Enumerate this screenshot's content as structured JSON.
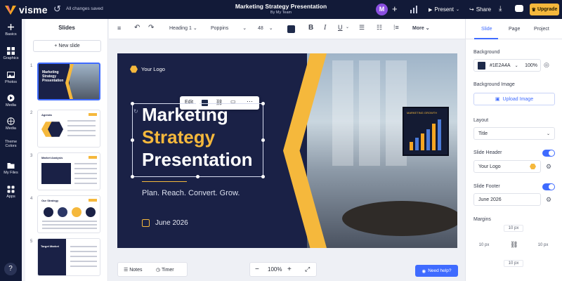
{
  "brand": {
    "name": "visme",
    "saved": "All changes saved"
  },
  "document": {
    "title": "Marketing Strategy Presentation",
    "owner": "By My Team"
  },
  "topbar": {
    "avatar_initial": "M",
    "present": "Present",
    "share": "Share",
    "upgrade": "Upgrade"
  },
  "rail": [
    {
      "label": "Basics",
      "icon": "plus-icon"
    },
    {
      "label": "Graphics",
      "icon": "grid-icon"
    },
    {
      "label": "Photos",
      "icon": "photo-icon"
    },
    {
      "label": "Media",
      "icon": "play-icon"
    },
    {
      "label": "Media",
      "icon": "globe-icon"
    },
    {
      "label": "Theme Colors",
      "icon": "palette-icon"
    },
    {
      "label": "My Files",
      "icon": "folder-icon"
    },
    {
      "label": "Apps",
      "icon": "apps-icon"
    }
  ],
  "slides_panel": {
    "title": "Slides",
    "new_slide": "+ New slide",
    "slides": [
      {
        "number": "1",
        "title": "Marketing Strategy Presentation"
      },
      {
        "number": "2",
        "title": "Agenda"
      },
      {
        "number": "3",
        "title": "Market Analysis"
      },
      {
        "number": "4",
        "title": "Our Strategy"
      },
      {
        "number": "5",
        "title": "Target Market"
      }
    ]
  },
  "toolbar": {
    "style": "Heading 1",
    "font": "Poppins",
    "size": "48",
    "more": "More",
    "text_color": "#1E2A4A"
  },
  "floating_toolbar": {
    "edit": "Edit"
  },
  "slide": {
    "logo_text": "Your Logo",
    "heading_line1": "Marketing",
    "heading_line2": "Strategy",
    "heading_line3": "Presentation",
    "tagline": "Plan. Reach. Convert. Grow.",
    "date": "June 2026",
    "tv_title": "MARKETING GROWTH",
    "colors": {
      "background": "#1a2146",
      "accent": "#f5b83c"
    }
  },
  "bottom": {
    "notes": "Notes",
    "timer": "Timer",
    "zoom": "100%",
    "help": "Need help?"
  },
  "right_panel": {
    "tabs": [
      "Slide",
      "Page",
      "Project"
    ],
    "active_tab": "Slide",
    "background_label": "Background",
    "background_hex": "#1E2A4A",
    "background_opacity": "100%",
    "background_image_label": "Background Image",
    "upload_image": "Upload Image",
    "layout_label": "Layout",
    "layout_value": "Title",
    "header_label": "Slide Header",
    "header_value": "Your Logo",
    "footer_label": "Slide Footer",
    "footer_value": "June 2026",
    "margins_label": "Margins",
    "margins": {
      "top": "10 px",
      "left": "10 px",
      "right": "10 px",
      "bottom": "10 px"
    }
  }
}
